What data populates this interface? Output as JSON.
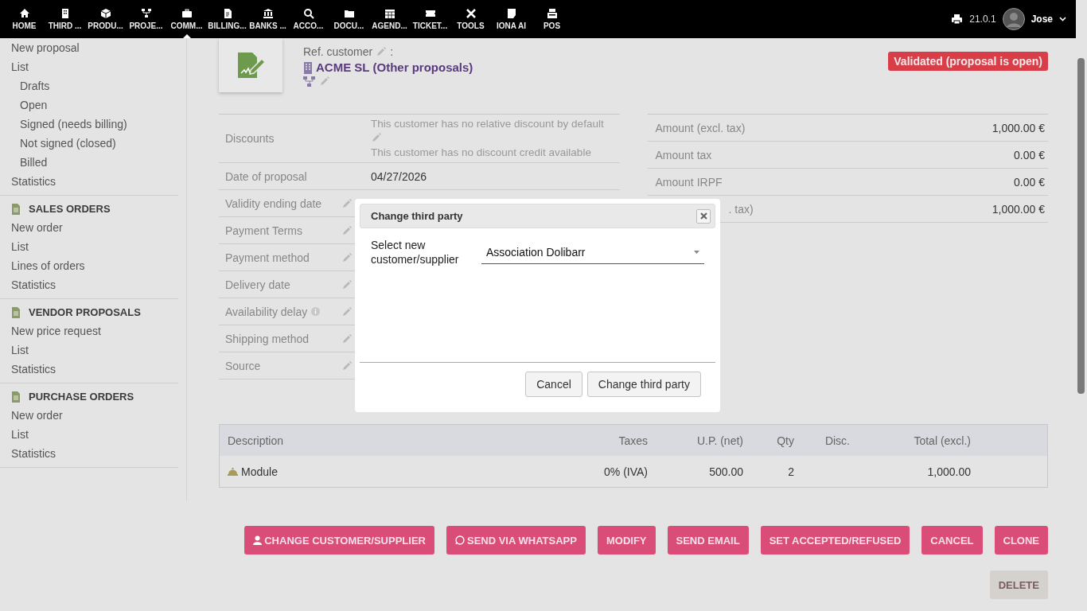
{
  "topnav": {
    "items": [
      {
        "label": "HOME",
        "selected": false
      },
      {
        "label": "THIRD ...",
        "selected": false
      },
      {
        "label": "PRODU...",
        "selected": false
      },
      {
        "label": "PROJE...",
        "selected": false
      },
      {
        "label": "COMM...",
        "selected": true
      },
      {
        "label": "BILLING...",
        "selected": false
      },
      {
        "label": "BANKS ...",
        "selected": false
      },
      {
        "label": "ACCO...",
        "selected": false
      },
      {
        "label": "DOCU...",
        "selected": false
      },
      {
        "label": "AGEND...",
        "selected": false
      },
      {
        "label": "TICKET...",
        "selected": false
      },
      {
        "label": "TOOLS",
        "selected": false
      },
      {
        "label": "IONA AI",
        "selected": false
      },
      {
        "label": "POS",
        "selected": false
      }
    ],
    "version": "21.0.1",
    "user": "Jose"
  },
  "sidebar": {
    "sections": [
      {
        "items": [
          {
            "label": "New proposal"
          },
          {
            "label": "List",
            "children": [
              {
                "label": "Drafts"
              },
              {
                "label": "Open"
              },
              {
                "label": "Signed (needs billing)"
              },
              {
                "label": "Not signed (closed)"
              },
              {
                "label": "Billed"
              }
            ]
          },
          {
            "label": "Statistics"
          }
        ]
      },
      {
        "title": "SALES ORDERS",
        "items": [
          {
            "label": "New order"
          },
          {
            "label": "List"
          },
          {
            "label": "Lines of orders"
          },
          {
            "label": "Statistics"
          }
        ]
      },
      {
        "title": "VENDOR PROPOSALS",
        "items": [
          {
            "label": "New price request"
          },
          {
            "label": "List"
          },
          {
            "label": "Statistics"
          }
        ]
      },
      {
        "title": "PURCHASE ORDERS",
        "items": [
          {
            "label": "New order"
          },
          {
            "label": "List"
          },
          {
            "label": "Statistics"
          }
        ]
      }
    ]
  },
  "header": {
    "ref_label": "Ref. customer",
    "ref_colon": ":",
    "customer": "ACME SL",
    "other_link": "(Other proposals)",
    "status": "Validated (proposal is open)"
  },
  "details": [
    {
      "label": "Discounts",
      "lines": [
        "This customer has no relative discount by default",
        "This customer has no discount credit available"
      ],
      "editable": false
    },
    {
      "label": "Date of proposal",
      "value": "04/27/2026",
      "editable": false
    },
    {
      "label": "Validity ending date",
      "editable": true
    },
    {
      "label": "Payment Terms",
      "editable": true
    },
    {
      "label": "Payment method",
      "editable": true
    },
    {
      "label": "Delivery date",
      "editable": true
    },
    {
      "label": "Availability delay",
      "editable": true,
      "info": true
    },
    {
      "label": "Shipping method",
      "editable": true
    },
    {
      "label": "Source",
      "editable": true
    }
  ],
  "totals": [
    {
      "label": "Amount (excl. tax)",
      "value": "1,000.00 €",
      "covered": false
    },
    {
      "label": "Amount tax",
      "value": "0.00 €",
      "covered": false
    },
    {
      "label": "Amount IRPF",
      "value": "0.00 €",
      "covered": false
    },
    {
      "label": ". tax)",
      "value": "1,000.00 €",
      "covered": true
    }
  ],
  "lines_table": {
    "columns": [
      "Description",
      "Taxes",
      "U.P. (net)",
      "Qty",
      "Disc.",
      "Total (excl.)"
    ],
    "rows": [
      {
        "description": "Module",
        "taxes": "0% (IVA)",
        "unit_price": "500.00",
        "qty": "2",
        "total": "1,000.00"
      }
    ]
  },
  "actions": [
    {
      "label": "CHANGE CUSTOMER/SUPPLIER",
      "kind": "primary"
    },
    {
      "label": "SEND VIA WHATSAPP",
      "kind": "primary"
    },
    {
      "label": "MODIFY",
      "kind": "primary"
    },
    {
      "label": "SEND EMAIL",
      "kind": "primary"
    },
    {
      "label": "SET ACCEPTED/REFUSED",
      "kind": "primary"
    },
    {
      "label": "CANCEL",
      "kind": "primary"
    },
    {
      "label": "CLONE",
      "kind": "primary"
    },
    {
      "label": "DELETE",
      "kind": "delete"
    }
  ],
  "dialog": {
    "title": "Change third party",
    "field_label": "Select new customer/supplier",
    "field_value": "Association Dolibarr",
    "buttons": [
      "Cancel",
      "Change third party"
    ]
  }
}
